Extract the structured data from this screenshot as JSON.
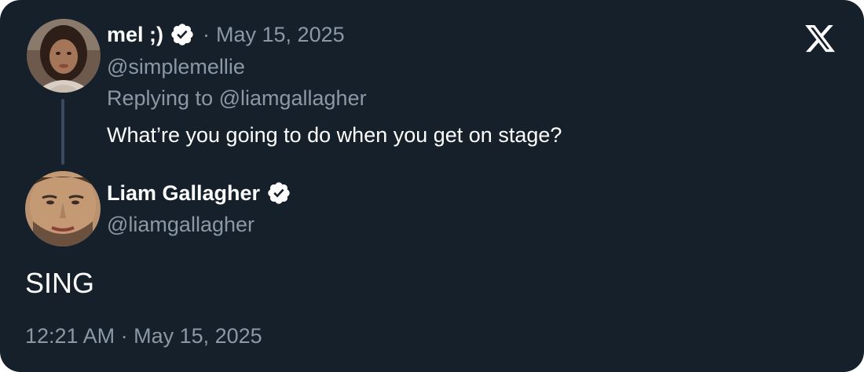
{
  "reply": {
    "display_name": "mel ;)",
    "separator": "·",
    "date": "May 15, 2025",
    "handle": "@simplemellie",
    "replying_to": "Replying to @liamgallagher",
    "text": "What’re you going to do when you get on stage?"
  },
  "tweet": {
    "display_name": "Liam Gallagher",
    "handle": "@liamgallagher",
    "text": "SING",
    "timestamp": "12:21 AM · May 15, 2025"
  },
  "icons": {
    "logo": "x-logo-icon",
    "verified": "verified-badge-icon",
    "avatar_reply": "avatar",
    "avatar_main": "avatar"
  },
  "colors": {
    "background": "#15202b",
    "primary_text": "#ffffff",
    "secondary_text": "#8b98a5",
    "thread_line": "#3b4a5b"
  }
}
